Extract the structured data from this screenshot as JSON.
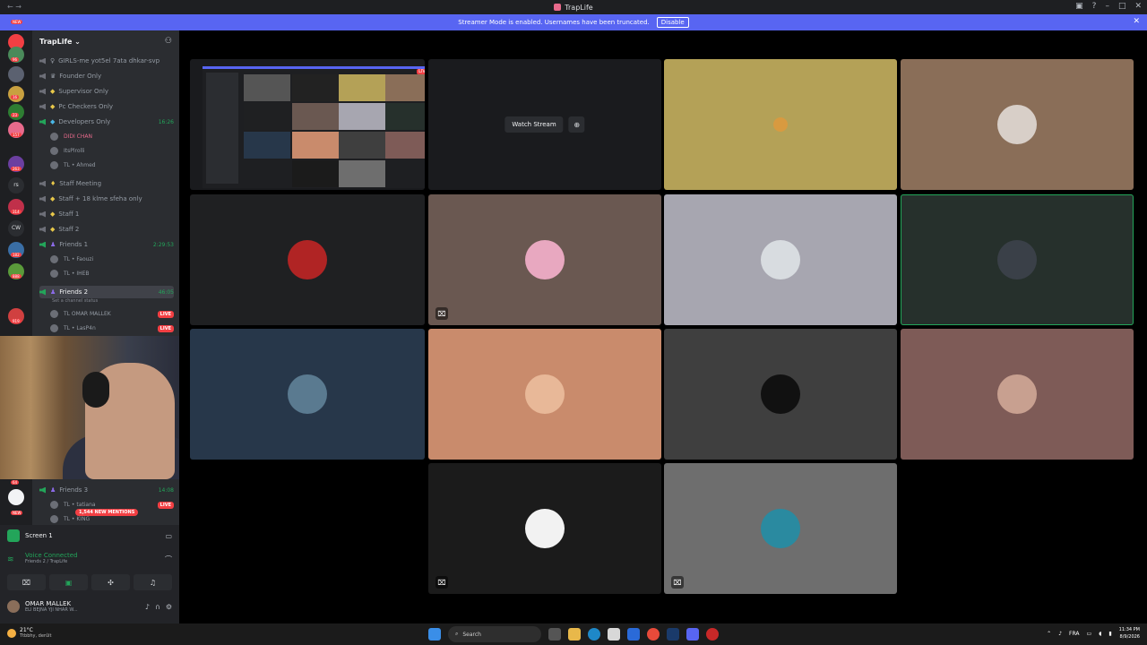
{
  "window": {
    "title": "TrapLife",
    "nav": "←  →"
  },
  "banner": {
    "text": "Streamer Mode is enabled. Usernames have been truncated.",
    "disable_label": "Disable"
  },
  "guild_badges": [
    "NEW",
    "96",
    "16",
    "23",
    "157",
    "263",
    "314",
    "182",
    "888",
    "919",
    "64",
    "NEW"
  ],
  "guild_labels": [
    "rs",
    "CW"
  ],
  "server": {
    "name": "TrapLife ⌄"
  },
  "channels": [
    {
      "label": "GIRLS-me yot5el 7ata dhkar-svp",
      "time": ""
    },
    {
      "label": "Founder Only",
      "time": ""
    },
    {
      "label": "Supervisor Only",
      "time": ""
    },
    {
      "label": "Pc Checkers Only",
      "time": ""
    },
    {
      "label": "Developers Only",
      "time": "16:26"
    },
    {
      "label": "Staff Meeting",
      "time": ""
    },
    {
      "label": "Staff + 18 klme sfeha only",
      "time": ""
    },
    {
      "label": "Staff 1",
      "time": ""
    },
    {
      "label": "Staff 2",
      "time": ""
    },
    {
      "label": "Friends 1",
      "time": "2:29:53"
    },
    {
      "label": "Friends 2",
      "time": "46:05"
    },
    {
      "label": "Friends 3",
      "time": "14:08"
    }
  ],
  "members": {
    "dev1": "DIDI CHAN",
    "dev2": "ItsPlrolli",
    "dev3": "TL • Ahmed",
    "f1a": "TL • Faouzi",
    "f1b": "TL • IHEB",
    "f2a": "TL OMAR MALLEK",
    "f2b": "TL • LasP4n",
    "f3a": "TL • tatiana",
    "f3b": "TL • KING"
  },
  "set_status": "Set a channel status",
  "live_label": "LIVE",
  "mentions": "1,544 NEW MENTIONS",
  "user_panel": {
    "screen_label": "Screen 1",
    "voice_connected": "Voice Connected",
    "voice_channel": "Friends 2 / TrapLife",
    "username": "OMAR MALLEK",
    "user_status": "ELI BEJNA YJI NHAR W..."
  },
  "stage": {
    "watch_stream": "Watch Stream",
    "tile_colors": [
      "#1a1b1e",
      "#1a1b1e",
      "#b4a157",
      "#8a6e58",
      "#1f2022",
      "#6a5851",
      "#a7a6b0",
      "#26302c",
      "#27374a",
      "#c98b6c",
      "#3f3f3f",
      "#7e5b57",
      "#1b1b1b",
      "#6e6e6e"
    ]
  },
  "taskbar": {
    "temp": "21°C",
    "weather_desc": "Ttbbhy, derûlt",
    "search_label": "Search",
    "lang": "FRA",
    "time": "11:34 PM",
    "date": "8/9/2026"
  }
}
